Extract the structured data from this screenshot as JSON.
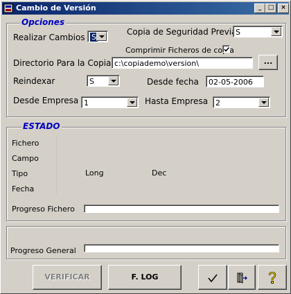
{
  "window": {
    "title": "Cambio de Versión",
    "minimize": "_",
    "maximize": "□",
    "close": "×"
  },
  "opciones": {
    "legend": "Opciones",
    "realizar_cambios": {
      "label": "Realizar Cambios",
      "value": "S"
    },
    "copia_seguridad": {
      "label": "Copia de Seguridad Previa",
      "value": "S"
    },
    "comprimir": {
      "label": "Comprimir Ficheros de copia",
      "checked": true
    },
    "directorio": {
      "label": "Directorio Para la Copia:",
      "value": "c:\\copiademo\\version\\",
      "browse_label": "..."
    },
    "reindexar": {
      "label": "Reindexar",
      "value": "S"
    },
    "desde_fecha": {
      "label": "Desde fecha",
      "value": "02-05-2006"
    },
    "desde_empresa": {
      "label": "Desde Empresa",
      "value": "1"
    },
    "hasta_empresa": {
      "label": "Hasta Empresa",
      "value": "2"
    }
  },
  "estado": {
    "legend": "ESTADO",
    "fichero_label": "Fichero",
    "campo_label": "Campo",
    "tipo_label": "Tipo",
    "tipo_long": "Long",
    "tipo_dec": "Dec",
    "fecha_label": "Fecha",
    "progreso_fichero_label": "Progreso Fichero",
    "progreso_fichero_value": 0
  },
  "general": {
    "progreso_general_label": "Progreso General",
    "progreso_general_value": 0
  },
  "buttons": {
    "verificar": "VERIFICAR",
    "flog": "F. LOG"
  },
  "icons": {
    "ok": "checkmark-icon",
    "exit": "exit-door-icon",
    "help": "help-icon"
  }
}
